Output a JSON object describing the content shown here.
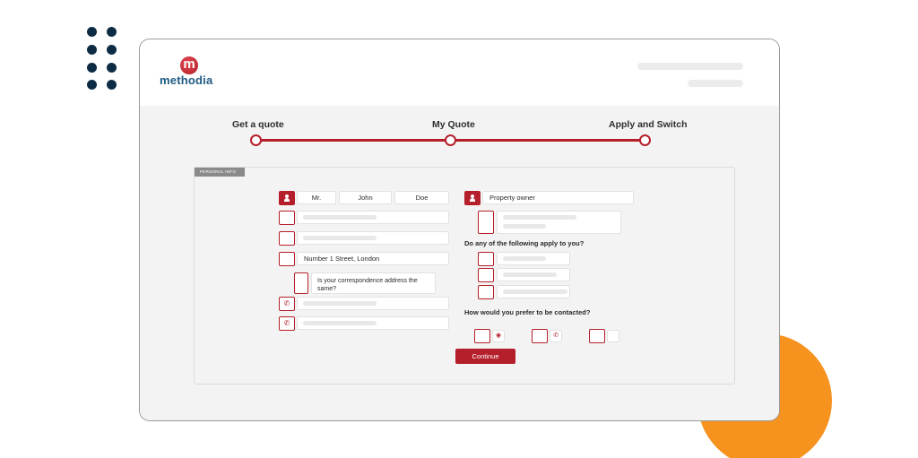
{
  "brand": {
    "logo_letter": "m",
    "name": "methodia"
  },
  "steps": [
    {
      "label": "Get a quote"
    },
    {
      "label": "My Quote"
    },
    {
      "label": "Apply and Switch"
    }
  ],
  "section_tag": "PERSONAL INFO",
  "form": {
    "title_value": "Mr.",
    "first_name": "John",
    "last_name": "Doe",
    "address": "Number 1 Street, London",
    "correspondence_question": "Is your correspondence address the same?",
    "property_status": "Property owner",
    "apply_question": "Do any of the following apply to you?",
    "contact_question": "How would you prefer to be contacted?",
    "continue_label": "Continue"
  },
  "icons": {
    "person": "person-icon",
    "phone": "phone-icon",
    "email": "email-icon"
  },
  "colors": {
    "accent": "#b51f2b",
    "brand_blue": "#1e5a82",
    "orange": "#f6921e",
    "dots": "#0d2c44"
  }
}
